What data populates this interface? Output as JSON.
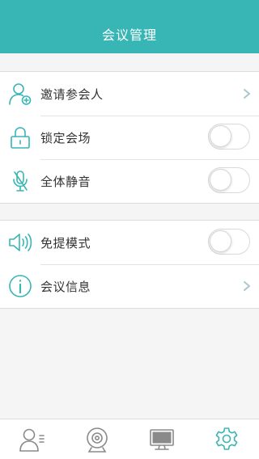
{
  "header": {
    "title": "会议管理"
  },
  "section1": {
    "items": [
      {
        "label": "邀请参会人",
        "icon": "add-person-icon",
        "control": "chevron"
      },
      {
        "label": "锁定会场",
        "icon": "lock-icon",
        "control": "toggle",
        "on": false
      },
      {
        "label": "全体静音",
        "icon": "mic-muted-icon",
        "control": "toggle",
        "on": false
      }
    ]
  },
  "section2": {
    "items": [
      {
        "label": "免提模式",
        "icon": "speaker-icon",
        "control": "toggle",
        "on": false
      },
      {
        "label": "会议信息",
        "icon": "info-icon",
        "control": "chevron"
      }
    ]
  },
  "tabbar": {
    "tabs": [
      {
        "icon": "participants-icon",
        "active": false
      },
      {
        "icon": "camera-icon",
        "active": false
      },
      {
        "icon": "monitor-icon",
        "active": false
      },
      {
        "icon": "settings-gear-icon",
        "active": true
      }
    ]
  },
  "colors": {
    "accent": "#38b5b5",
    "icon_inactive": "#8a8a8a",
    "chevron": "#a8c8cc"
  }
}
